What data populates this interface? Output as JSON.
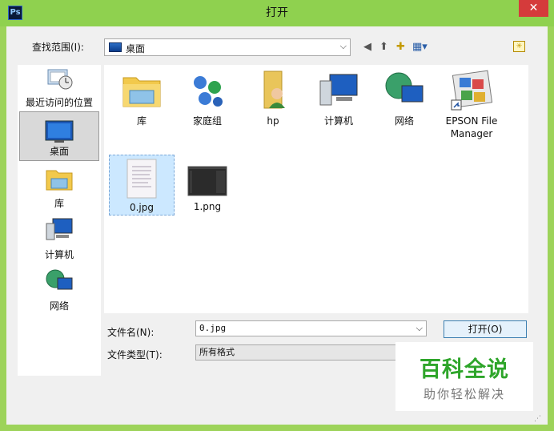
{
  "window": {
    "title": "打开",
    "app_icon_text": "Ps",
    "close_label": "✕"
  },
  "look_in": {
    "label": "查找范围(I):",
    "value": "桌面"
  },
  "toolbar": {
    "back": "◀",
    "up": "⬆",
    "new_folder": "✚",
    "view": "▦▾"
  },
  "extra_icon": "✳",
  "places": [
    {
      "label": "最近访问的位置",
      "icon": "recent-icon"
    },
    {
      "label": "桌面",
      "icon": "desktop-icon",
      "selected": true
    },
    {
      "label": "库",
      "icon": "library-icon"
    },
    {
      "label": "计算机",
      "icon": "computer-icon"
    },
    {
      "label": "网络",
      "icon": "network-icon"
    }
  ],
  "files": [
    {
      "name": "库",
      "icon": "library-folder-icon"
    },
    {
      "name": "家庭组",
      "icon": "homegroup-icon"
    },
    {
      "name": "hp",
      "icon": "user-folder-icon"
    },
    {
      "name": "计算机",
      "icon": "computer-icon"
    },
    {
      "name": "网络",
      "icon": "network-icon"
    },
    {
      "name": "EPSON File Manager",
      "icon": "epson-shortcut-icon"
    },
    {
      "name": "0.jpg",
      "icon": "image-thumbnail-icon",
      "selected": true
    },
    {
      "name": "1.png",
      "icon": "image-thumbnail-icon"
    }
  ],
  "filename": {
    "label": "文件名(N):",
    "value": "0.jpg"
  },
  "filetype": {
    "label": "文件类型(T):",
    "value": "所有格式"
  },
  "open_button": "打开(O)",
  "watermark": {
    "main": "百科全说",
    "sub": "助你轻松解决"
  }
}
